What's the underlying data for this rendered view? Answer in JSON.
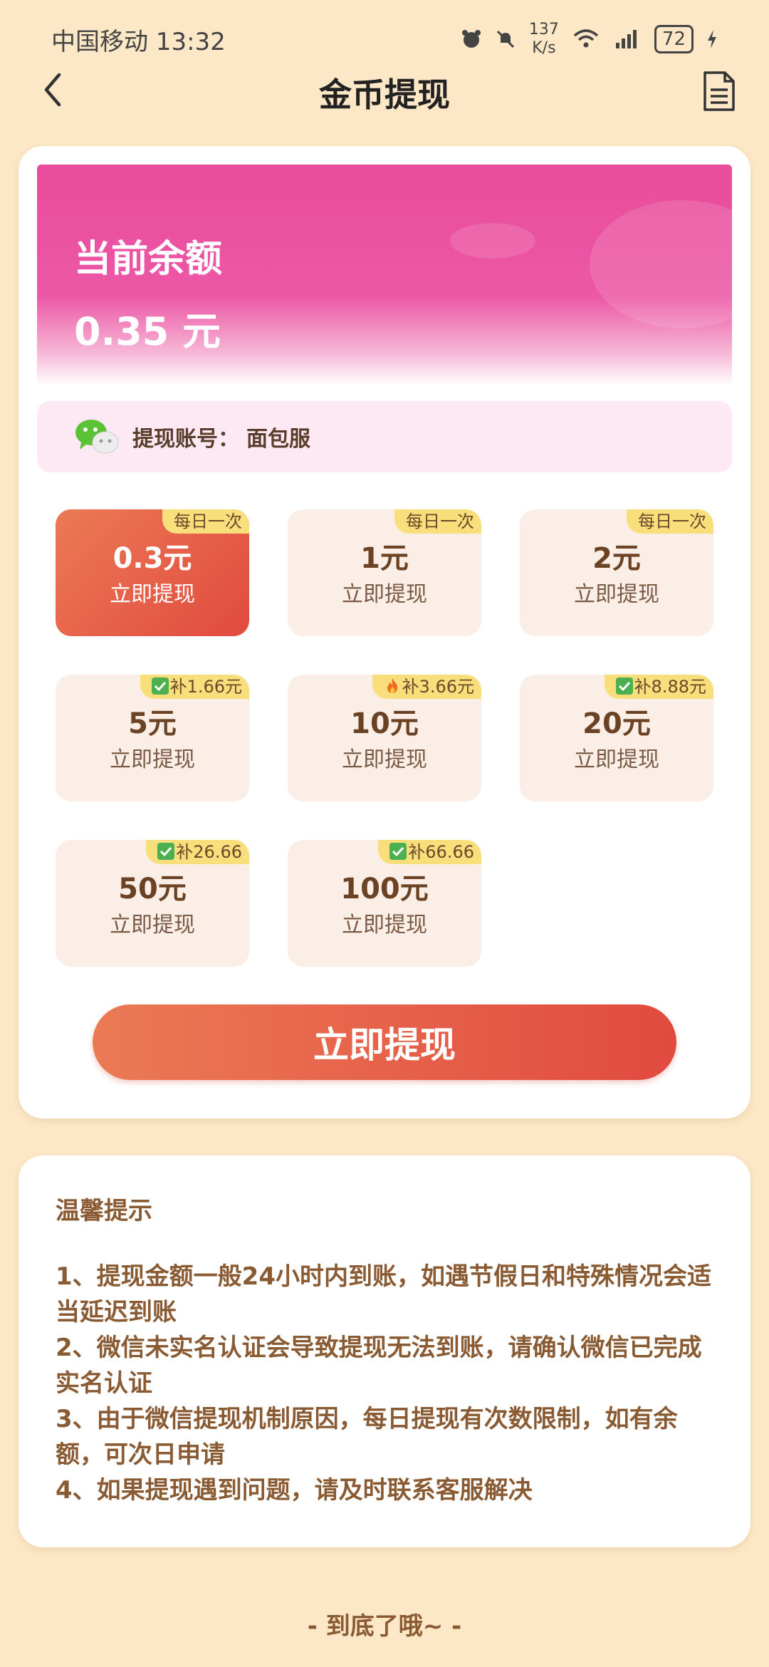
{
  "status_bar": {
    "carrier_time": "中国移动 13:32",
    "speed_value": "137",
    "speed_unit": "K/s",
    "battery": "72"
  },
  "nav": {
    "title": "金币提现",
    "back_icon": "chevron-left-icon",
    "right_icon": "document-icon"
  },
  "balance": {
    "label": "当前余额",
    "value": "0.35 元"
  },
  "account": {
    "label": "提现账号：",
    "name": "面包服",
    "icon": "wechat-icon"
  },
  "options": [
    {
      "amount": "0.3元",
      "label": "立即提现",
      "tag": "每日一次",
      "tag_icon": "",
      "selected": true
    },
    {
      "amount": "1元",
      "label": "立即提现",
      "tag": "每日一次",
      "tag_icon": "",
      "selected": false
    },
    {
      "amount": "2元",
      "label": "立即提现",
      "tag": "每日一次",
      "tag_icon": "",
      "selected": false
    },
    {
      "amount": "5元",
      "label": "立即提现",
      "tag": "补1.66元",
      "tag_icon": "check-icon",
      "selected": false
    },
    {
      "amount": "10元",
      "label": "立即提现",
      "tag": "补3.66元",
      "tag_icon": "fire-icon",
      "selected": false
    },
    {
      "amount": "20元",
      "label": "立即提现",
      "tag": "补8.88元",
      "tag_icon": "check-icon",
      "selected": false
    },
    {
      "amount": "50元",
      "label": "立即提现",
      "tag": "补26.66",
      "tag_icon": "check-icon",
      "selected": false
    },
    {
      "amount": "100元",
      "label": "立即提现",
      "tag": "补66.66",
      "tag_icon": "check-icon",
      "selected": false
    }
  ],
  "withdraw_button": "立即提现",
  "tips": {
    "title": "温馨提示",
    "items": [
      "1、提现金额一般24小时内到账，如遇节假日和特殊情况会适当延迟到账",
      "2、微信未实名认证会导致提现无法到账，请确认微信已完成实名认证",
      "3、由于微信提现机制原因，每日提现有次数限制，如有余额，可次日申请",
      "4、如果提现遇到问题，请及时联系客服解决"
    ]
  },
  "footer": "- 到底了哦~ -",
  "colors": {
    "background": "#FCE7C6",
    "accent": "#E14A3F",
    "banner": "#E94C9B",
    "tag": "#F8DF7C"
  }
}
